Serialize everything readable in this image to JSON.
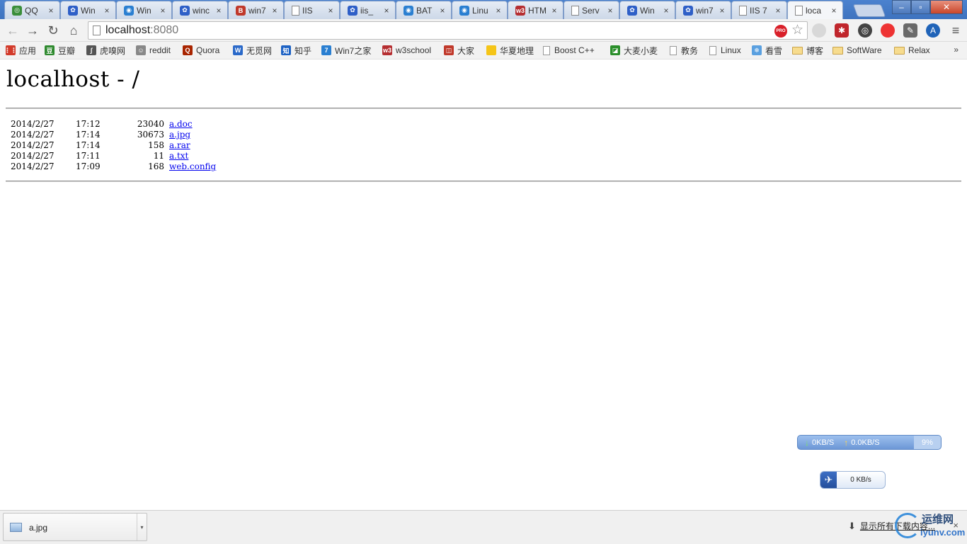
{
  "browser": {
    "tabs": [
      {
        "label": "QQ",
        "icon": "chrome-icon",
        "color": "#3a8e3a",
        "glyph": "◎"
      },
      {
        "label": "Win",
        "icon": "baidu-paw-icon",
        "color": "#2e5fc7",
        "glyph": "✿"
      },
      {
        "label": "Win",
        "icon": "globe-icon",
        "color": "#2a7fd1",
        "glyph": "◉"
      },
      {
        "label": "winc",
        "icon": "baidu-paw-icon",
        "color": "#2e5fc7",
        "glyph": "✿"
      },
      {
        "label": "win7",
        "icon": "site-b-icon",
        "color": "#c0392b",
        "glyph": "B"
      },
      {
        "label": "IIS",
        "icon": "page-icon",
        "color": "#aaaaaa",
        "glyph": ""
      },
      {
        "label": "iis_",
        "icon": "baidu-paw-icon",
        "color": "#2e5fc7",
        "glyph": "✿"
      },
      {
        "label": "BAT",
        "icon": "globe-icon",
        "color": "#2a7fd1",
        "glyph": "◉"
      },
      {
        "label": "Linu",
        "icon": "globe-icon",
        "color": "#2a7fd1",
        "glyph": "◉"
      },
      {
        "label": "HTM",
        "icon": "w3-icon",
        "color": "#b52e31",
        "glyph": "w3"
      },
      {
        "label": "Serv",
        "icon": "page-icon",
        "color": "#aaaaaa",
        "glyph": ""
      },
      {
        "label": "Win",
        "icon": "baidu-paw-icon",
        "color": "#2e5fc7",
        "glyph": "✿"
      },
      {
        "label": "win7",
        "icon": "baidu-paw-icon",
        "color": "#2e5fc7",
        "glyph": "✿"
      },
      {
        "label": "IIS 7",
        "icon": "page-icon",
        "color": "#aaaaaa",
        "glyph": ""
      },
      {
        "label": "loca",
        "icon": "page-icon",
        "color": "#aaaaaa",
        "glyph": "",
        "active": true
      }
    ],
    "tab_close": "×",
    "window_controls": {
      "minimize": "–",
      "maximize": "▫",
      "close": "✕"
    },
    "nav": {
      "back": "←",
      "forward": "→",
      "reload": "↻",
      "home": "⌂"
    },
    "address": {
      "host": "localhost",
      "port": ":8080"
    },
    "pro_badge": "PRO",
    "star": "☆",
    "menu": "≡",
    "bookmarks": [
      {
        "label": "应用",
        "icon": "apps-grid-icon",
        "color": "#d23a2a",
        "glyph": "⋮⋮"
      },
      {
        "label": "豆瓣",
        "icon": "douban-icon",
        "color": "#2f8a2f",
        "glyph": "豆"
      },
      {
        "label": "虎嗅网",
        "icon": "huxiu-icon",
        "color": "#555555",
        "glyph": "∫"
      },
      {
        "label": "reddit",
        "icon": "reddit-icon",
        "color": "#888888",
        "glyph": "☺"
      },
      {
        "label": "Quora",
        "icon": "quora-icon",
        "color": "#a82400",
        "glyph": "Q"
      },
      {
        "label": "无觅网",
        "icon": "wumi-icon",
        "color": "#2a69c9",
        "glyph": "W"
      },
      {
        "label": "知乎",
        "icon": "zhihu-icon",
        "color": "#1d62c4",
        "glyph": "知"
      },
      {
        "label": "Win7之家",
        "icon": "win7home-icon",
        "color": "#2a7fd1",
        "glyph": "7"
      },
      {
        "label": "w3school",
        "icon": "w3-icon",
        "color": "#b52e31",
        "glyph": "w3"
      },
      {
        "label": "大家",
        "icon": "dajia-icon",
        "color": "#c0392b",
        "glyph": "◫"
      },
      {
        "label": "华夏地理",
        "icon": "natgeo-icon",
        "color": "#f5c518",
        "glyph": ""
      },
      {
        "label": "Boost C++",
        "icon": "page-icon",
        "type": "page"
      },
      {
        "label": "大麦小麦",
        "icon": "damai-icon",
        "color": "#2b8f2b",
        "glyph": "◪"
      },
      {
        "label": "教务",
        "icon": "page-icon",
        "type": "page"
      },
      {
        "label": "Linux",
        "icon": "page-icon",
        "type": "page"
      },
      {
        "label": "看雪",
        "icon": "snowflake-icon",
        "color": "#5aa0e0",
        "glyph": "❄"
      },
      {
        "label": "博客",
        "icon": "folder-icon",
        "type": "folder"
      },
      {
        "label": "SoftWare",
        "icon": "folder-icon",
        "type": "folder"
      },
      {
        "label": "Relax",
        "icon": "folder-icon",
        "type": "folder"
      }
    ],
    "bookmarks_more": "»"
  },
  "page": {
    "title": "localhost - /",
    "entries": [
      {
        "date": "2014/2/27",
        "time": "17:12",
        "size": "23040",
        "name": "a.doc"
      },
      {
        "date": "2014/2/27",
        "time": "17:14",
        "size": "30673",
        "name": "a.jpg"
      },
      {
        "date": "2014/2/27",
        "time": "17:14",
        "size": "158",
        "name": "a.rar"
      },
      {
        "date": "2014/2/27",
        "time": "17:11",
        "size": "11",
        "name": "a.txt"
      },
      {
        "date": "2014/2/27",
        "time": "17:09",
        "size": "168",
        "name": "web.config"
      }
    ]
  },
  "netspeed": {
    "down": "0KB/S",
    "up": "0.0KB/S",
    "percent": "9%",
    "down_arrow": "↓",
    "up_arrow": "↑"
  },
  "bird_widget": {
    "speed": "0 KB/s",
    "glyph": "✈"
  },
  "download_shelf": {
    "item_name": "a.jpg",
    "item_menu": "▾",
    "show_all": "显示所有下载内容...",
    "download_arrow": "⬇",
    "close": "×"
  },
  "watermark": {
    "cn": "运维网",
    "en": "iyunv.com"
  }
}
